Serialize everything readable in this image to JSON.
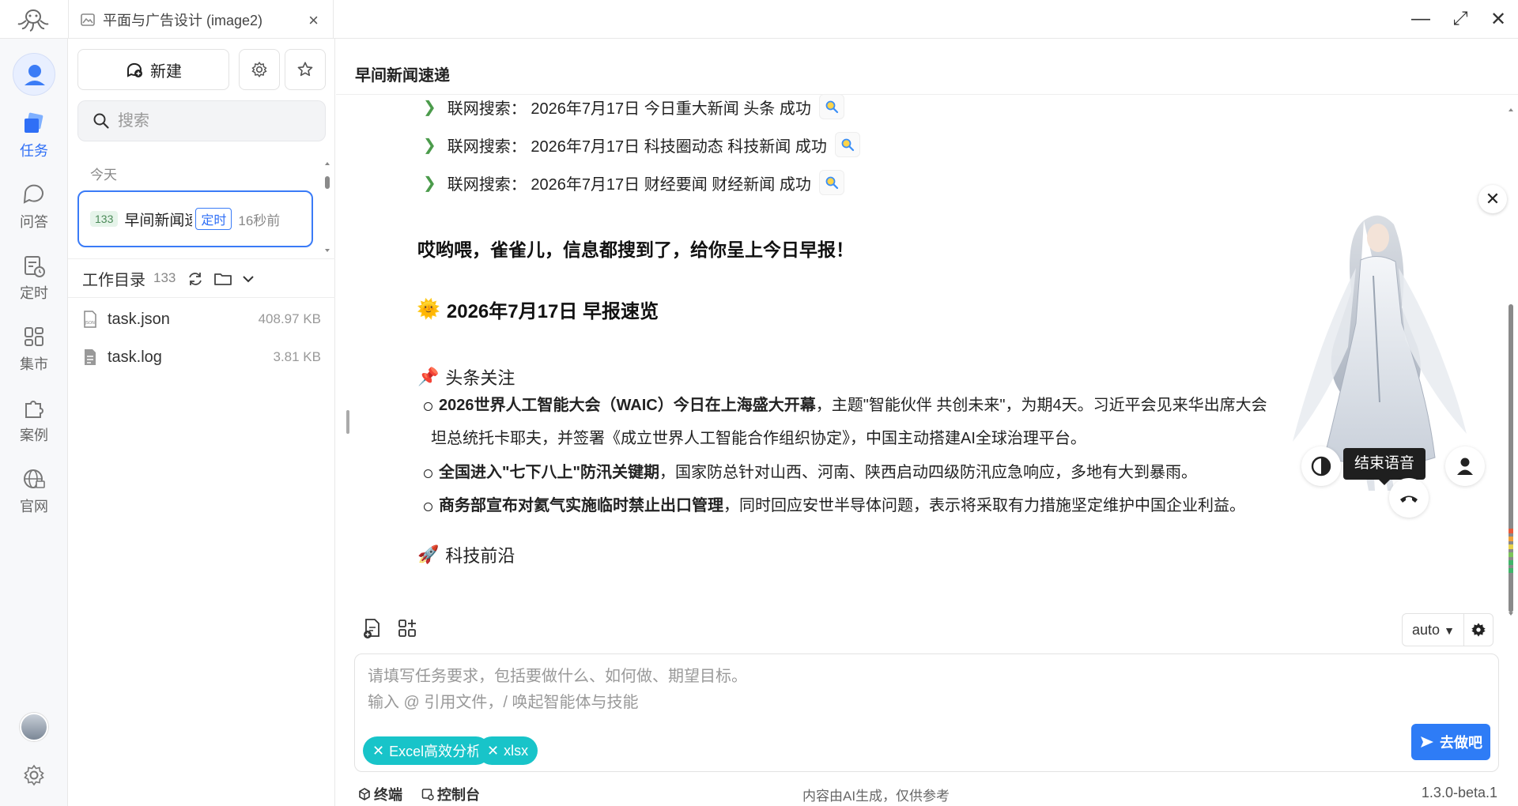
{
  "titlebar": {
    "tab_title": "平面与广告设计 (image2)",
    "tab_close": "×",
    "min": "—",
    "max": "⤢",
    "close": "✕"
  },
  "rail": {
    "items": [
      {
        "label": "任务",
        "icon": "layers-icon"
      },
      {
        "label": "问答",
        "icon": "chat-icon"
      },
      {
        "label": "定时",
        "icon": "schedule-icon"
      },
      {
        "label": "集市",
        "icon": "grid-icon"
      },
      {
        "label": "案例",
        "icon": "puzzle-icon"
      },
      {
        "label": "官网",
        "icon": "globe-icon"
      }
    ]
  },
  "tasks": {
    "new_label": "新建",
    "search_placeholder": "搜索",
    "group_today": "今天",
    "card": {
      "num": "133",
      "title": "早间新闻速递",
      "tag": "定时",
      "time": "16秒前"
    },
    "workdir_label": "工作目录",
    "workdir_count": "133",
    "files": [
      {
        "name": "task.json",
        "size": "408.97 KB"
      },
      {
        "name": "task.log",
        "size": "3.81 KB"
      }
    ]
  },
  "main": {
    "title": "早间新闻速递",
    "searches": [
      "联网搜索： 2026年7月17日 今日重大新闻 头条 成功",
      "联网搜索： 2026年7月17日 科技圈动态 科技新闻 成功",
      "联网搜索： 2026年7月17日 财经要闻 财经新闻 成功"
    ],
    "intro": "哎哟喂，雀雀儿，信息都搜到了，给你呈上今日早报！",
    "date_heading": "2026年7月17日 早报速览",
    "date_emoji": "🌞",
    "section1": {
      "emoji": "📌",
      "label": "头条关注"
    },
    "bullets": [
      {
        "bold": "2026世界人工智能大会（WAIC）今日在上海盛大开幕",
        "text": "，主题\"智能伙伴 共创未来\"，为期4天。习近平会见来华出席大会",
        "cont": "坦总统托卡耶夫，并签署《成立世界人工智能合作组织协定》，中国主动搭建AI全球治理平台。"
      },
      {
        "bold": "全国进入\"七下八上\"防汛关键期",
        "text": "，国家防总针对山西、河南、陕西启动四级防汛应急响应，多地有大到暴雨。",
        "cont": ""
      },
      {
        "bold": "商务部宣布对氦气实施临时禁止出口管理",
        "text": "，同时回应安世半导体问题，表示将采取有力措施坚定维护中国企业利益。",
        "cont": ""
      }
    ],
    "section2": {
      "emoji": "🚀",
      "label": "科技前沿"
    }
  },
  "voice": {
    "tip": "结束语音",
    "close": "✕"
  },
  "composer": {
    "model": "auto",
    "model_caret": "▼",
    "placeholder": "请填写任务要求，包括要做什么、如何做、期望目标。\n输入 @ 引用文件，/ 唤起智能体与技能",
    "chips": [
      "Excel高效分析",
      "xlsx"
    ],
    "chip_x": "✕",
    "go_label": "去做吧"
  },
  "footer": {
    "terminal": "终端",
    "console": "控制台",
    "note": "内容由AI生成，仅供参考",
    "version": "1.3.0-beta.1"
  },
  "colors": {
    "accent": "#2f6ff6",
    "chip": "#18c4c9",
    "go": "#2e7cf6"
  }
}
